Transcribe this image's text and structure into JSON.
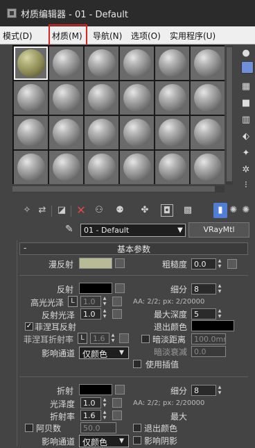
{
  "window": {
    "title": "材质编辑器 - 01 - Default"
  },
  "menubar": {
    "items": [
      {
        "label": "模式(D)"
      },
      {
        "label": "材质(M)"
      },
      {
        "label": "导航(N)"
      },
      {
        "label": "选项(O)"
      },
      {
        "label": "实用程序(U)"
      }
    ],
    "highlighted": "材质(M)",
    "highlight_color": "#e0201f"
  },
  "sample_slots": {
    "rows": 4,
    "cols": 6,
    "selected_index": 0,
    "selected_slot_color": "#b2b17c",
    "default_slot_color": "#9a9a9a"
  },
  "side_toolbar": {
    "icons": [
      "sample-type-icon",
      "backlight-icon",
      "background-icon",
      "sample-uv-tiling-icon",
      "video-color-check-icon",
      "make-preview-icon",
      "options-icon",
      "select-by-material-icon",
      "material-map-navigator-icon"
    ]
  },
  "bottom_toolbar": {
    "icons": [
      "get-material-icon",
      "put-to-scene-icon",
      "assign-to-selection-icon",
      "reset-map-icon",
      "make-unique-icon",
      "put-to-library-icon",
      "material-id-channel-icon",
      "show-shaded-in-viewport-icon",
      "show-end-result-icon",
      "go-to-parent-icon",
      "go-forward-to-sibling-icon"
    ],
    "active_icon": "show-end-result-icon",
    "active_color": "#4f7ed4"
  },
  "material": {
    "name": "01 - Default",
    "type": "VRayMtl"
  },
  "rollout": {
    "title": "基本参数",
    "toggle": "-"
  },
  "diffuse": {
    "label": "漫反射",
    "color": "#b9bb97",
    "roughness_label": "粗糙度",
    "roughness": "0.0"
  },
  "reflection": {
    "label": "反射",
    "color": "#000000",
    "glossiness_label": "高光光泽",
    "glossiness_lock": "L",
    "glossiness": "1.0",
    "refl_glossiness_label": "反射光泽",
    "refl_glossiness": "1.0",
    "fresnel_label": "菲涅耳反射",
    "fresnel_checked": true,
    "fresnel_ior_label": "菲涅耳折射率",
    "fresnel_ior_lock": "L",
    "fresnel_ior": "1.6",
    "subdivs_label": "细分",
    "subdivs": "8",
    "aa_info": "AA: 2/2; px: 2/20000",
    "max_depth_label": "最大深度",
    "max_depth": "5",
    "exit_color_label": "退出颜色",
    "exit_color": "#000000",
    "dim_distance_label": "暗淡距离",
    "dim_distance": "100.0mm",
    "dim_falloff_label": "暗淡衰减",
    "dim_falloff": "0.0",
    "affect_channels_label": "影响通道",
    "affect_channels": "仅颜色",
    "use_interpolation_label": "使用插值"
  },
  "refraction": {
    "label": "折射",
    "color": "#000000",
    "glossiness_label": "光泽度",
    "glossiness": "1.0",
    "ior_label": "折射率",
    "ior": "1.6",
    "abbe_label": "阿贝数",
    "abbe": "50.0",
    "subdivs_label": "细分",
    "subdivs": "8",
    "aa_info": "AA: 2/2; px: 2/20000",
    "max_depth_label": "最大",
    "exit_color_label": "退出颜色",
    "affect_channels_label": "影响通道",
    "affect_channels": "仅颜色",
    "affect_shadows_label": "影响阴影"
  }
}
